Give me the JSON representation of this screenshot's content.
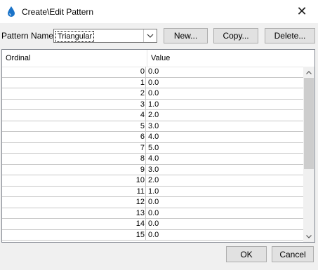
{
  "window": {
    "title": "Create\\Edit Pattern",
    "icon": "droplet-icon",
    "close_label": "✕"
  },
  "toolbar": {
    "pattern_label": "Pattern Name:",
    "selected_pattern": "Triangular",
    "new_label": "New...",
    "copy_label": "Copy...",
    "delete_label": "Delete..."
  },
  "table": {
    "columns": [
      "Ordinal",
      "Value"
    ],
    "rows": [
      {
        "ordinal": "0",
        "value": "0.0"
      },
      {
        "ordinal": "1",
        "value": "0.0"
      },
      {
        "ordinal": "2",
        "value": "0.0"
      },
      {
        "ordinal": "3",
        "value": "1.0"
      },
      {
        "ordinal": "4",
        "value": "2.0"
      },
      {
        "ordinal": "5",
        "value": "3.0"
      },
      {
        "ordinal": "6",
        "value": "4.0"
      },
      {
        "ordinal": "7",
        "value": "5.0"
      },
      {
        "ordinal": "8",
        "value": "4.0"
      },
      {
        "ordinal": "9",
        "value": "3.0"
      },
      {
        "ordinal": "10",
        "value": "2.0"
      },
      {
        "ordinal": "11",
        "value": "1.0"
      },
      {
        "ordinal": "12",
        "value": "0.0"
      },
      {
        "ordinal": "13",
        "value": "0.0"
      },
      {
        "ordinal": "14",
        "value": "0.0"
      },
      {
        "ordinal": "15",
        "value": "0.0"
      }
    ]
  },
  "footer": {
    "ok_label": "OK",
    "cancel_label": "Cancel"
  },
  "colors": {
    "accent": "#1a73c8",
    "background": "#f0f0f0",
    "grid": "#c8c8c8"
  }
}
